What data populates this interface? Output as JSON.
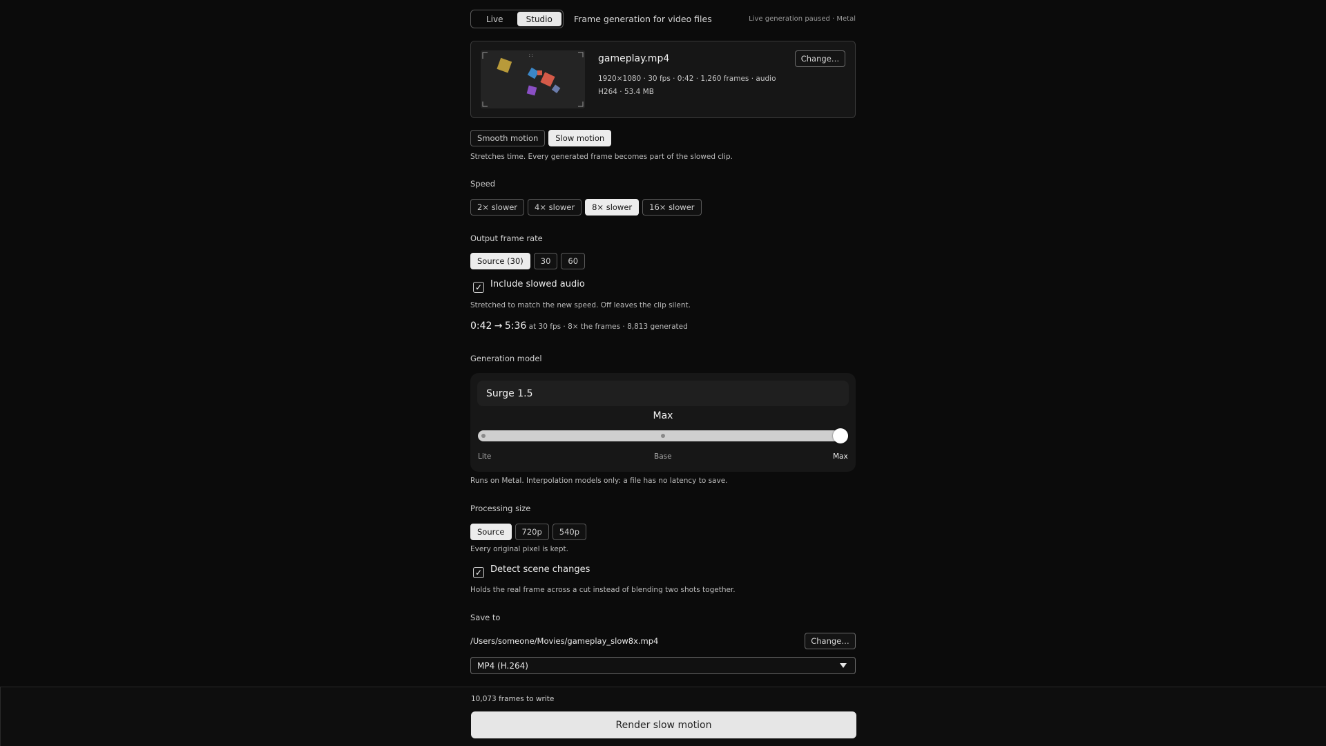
{
  "header": {
    "mode_tabs": [
      {
        "label": "Live",
        "active": false
      },
      {
        "label": "Studio",
        "active": true
      }
    ],
    "subtitle": "Frame generation for video files",
    "status": "Live generation paused · Metal"
  },
  "file": {
    "name": "gameplay.mp4",
    "meta_line1": "1920×1080 · 30 fps · 0:42 · 1,260 frames · audio",
    "meta_line2": "H264 · 53.4 MB",
    "change_label": "Change…"
  },
  "mode": {
    "options": [
      {
        "label": "Smooth motion",
        "active": false
      },
      {
        "label": "Slow motion",
        "active": true
      }
    ],
    "hint": "Stretches time. Every generated frame becomes part of the slowed clip."
  },
  "speed": {
    "label": "Speed",
    "options": [
      {
        "label": "2× slower",
        "active": false
      },
      {
        "label": "4× slower",
        "active": false
      },
      {
        "label": "8× slower",
        "active": true
      },
      {
        "label": "16× slower",
        "active": false
      }
    ]
  },
  "frame_rate": {
    "label": "Output frame rate",
    "options": [
      {
        "label": "Source (30)",
        "active": true
      },
      {
        "label": "30",
        "active": false
      },
      {
        "label": "60",
        "active": false
      }
    ]
  },
  "audio": {
    "checked": true,
    "label": "Include slowed audio",
    "hint": "Stretched to match the new speed. Off leaves the clip silent."
  },
  "summary": {
    "duration_from": "0:42",
    "arrow": "→",
    "duration_to": "5:36",
    "fps": "at 30 fps",
    "detail": " · 8× the frames · 8,813 generated"
  },
  "model": {
    "label": "Generation model",
    "name": "Surge 1.5",
    "tier_title": "Max",
    "tiers": [
      "Lite",
      "Base",
      "Max"
    ],
    "selected_tier_index": 2,
    "hint": "Runs on Metal. Interpolation models only: a file has no latency to save."
  },
  "processing": {
    "label": "Processing size",
    "options": [
      {
        "label": "Source",
        "active": true
      },
      {
        "label": "720p",
        "active": false
      },
      {
        "label": "540p",
        "active": false
      }
    ],
    "hint": "Every original pixel is kept."
  },
  "scene": {
    "checked": true,
    "label": "Detect scene changes",
    "hint": "Holds the real frame across a cut instead of blending two shots together."
  },
  "save": {
    "label": "Save to",
    "path": "/Users/someone/Movies/gameplay_slow8x.mp4",
    "change_label": "Change…",
    "format": "MP4 (H.264)"
  },
  "footer": {
    "count": "10,073 frames to write",
    "render_label": "Render slow motion"
  },
  "colors": {
    "background": "#0b0b0b",
    "accent": "#ececec",
    "card": "#161616"
  }
}
